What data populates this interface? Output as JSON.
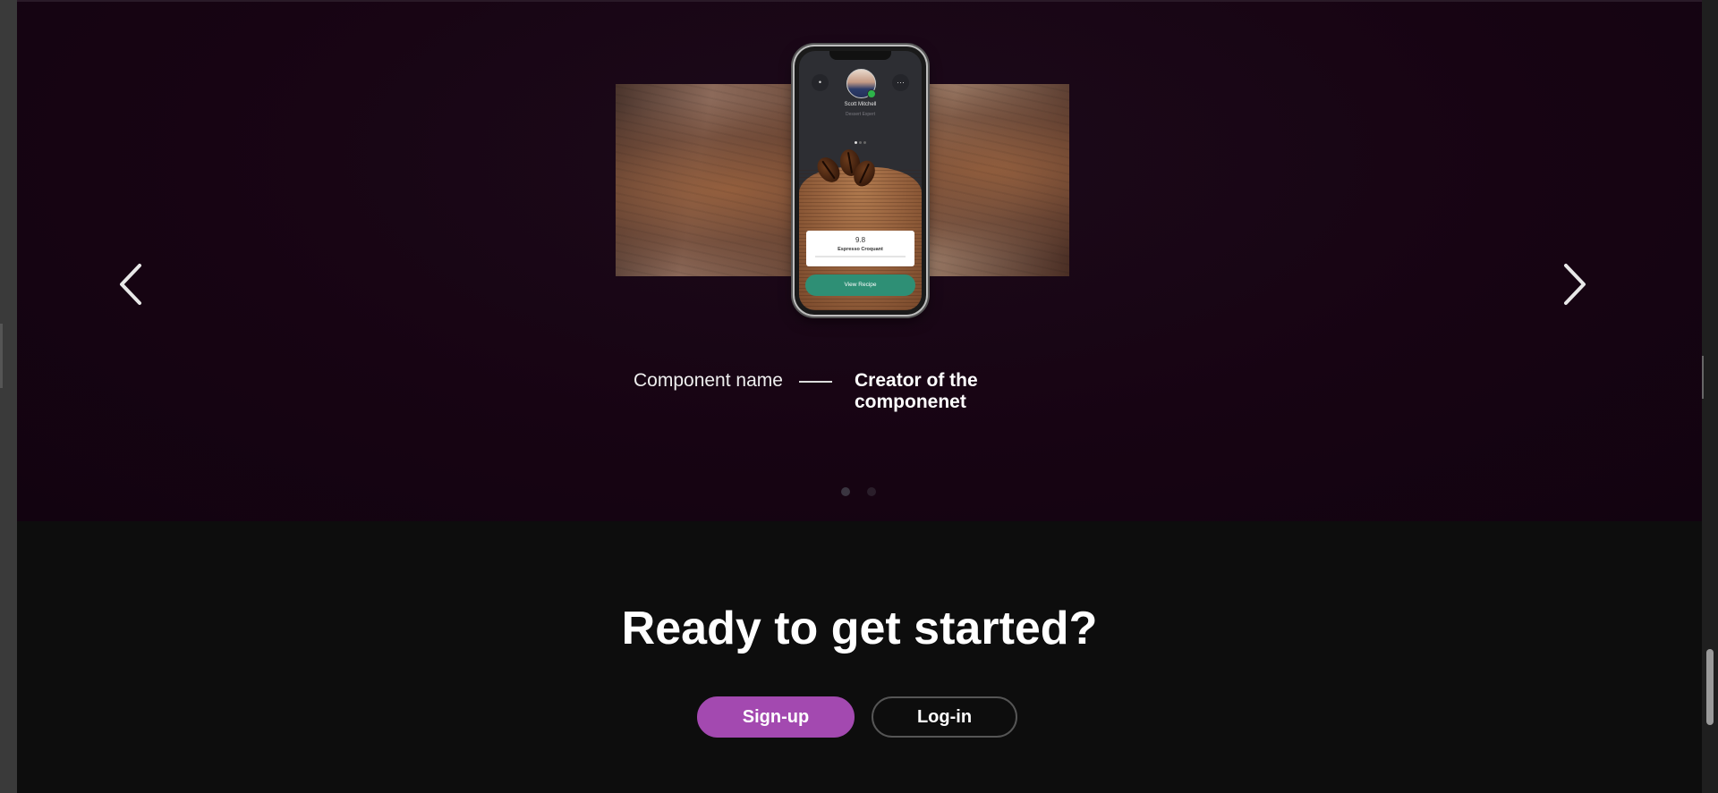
{
  "showcase": {
    "component_name": "Component name",
    "creator": "Creator of the componenet",
    "prev_icon": "chevron-left-icon",
    "next_icon": "chevron-right-icon",
    "carousel": {
      "slides": 2,
      "active_index": 0
    }
  },
  "phone_preview": {
    "profile_name": "Scott Mitchell",
    "profile_role": "Dessert Expert",
    "more_icon": "ellipsis-icon",
    "back_icon": "dot-icon",
    "rating": "9.8",
    "dish_title": "Espresso Croquant",
    "button_label": "View Recipe"
  },
  "cta": {
    "heading": "Ready to get started?",
    "signup_label": "Sign-up",
    "login_label": "Log-in"
  },
  "colors": {
    "showcase_bg": "#170413",
    "page_bg": "#0d0d0d",
    "signup_accent": "#a349b0",
    "recipe_button": "#2e8f75"
  }
}
